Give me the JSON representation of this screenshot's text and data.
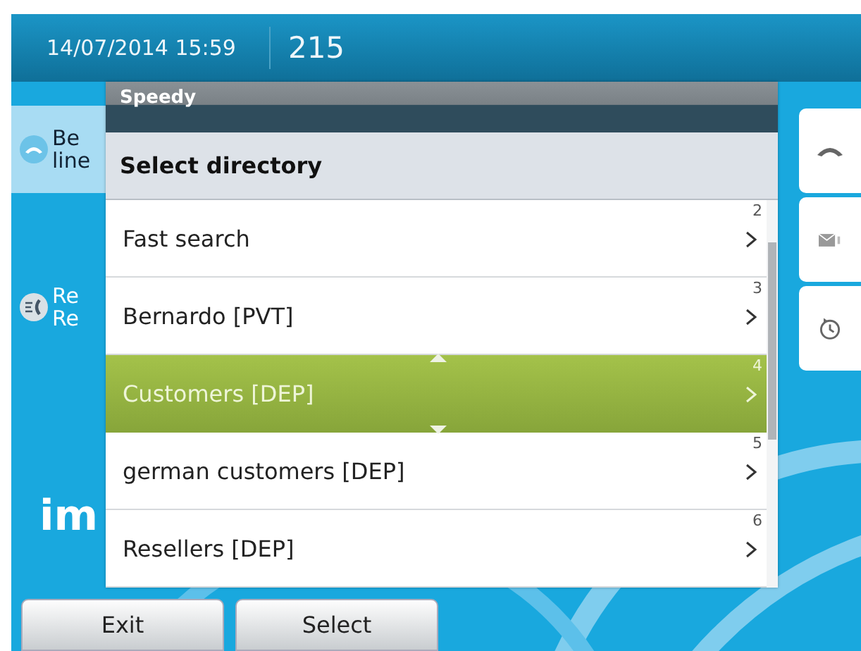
{
  "status_bar": {
    "datetime": "14/07/2014 15:59",
    "extension": "215"
  },
  "entries": [
    {
      "kind": "call",
      "line_1": "Be",
      "line_2": "line"
    },
    {
      "kind": "redial",
      "line_1": "Re",
      "line_2": "Re"
    }
  ],
  "logo_fragment": "im",
  "dialog": {
    "title": "Speedy",
    "heading": "Select directory",
    "items": [
      {
        "label": "Fast search",
        "number": "2",
        "selected": false
      },
      {
        "label": "Bernardo [PVT]",
        "number": "3",
        "selected": false
      },
      {
        "label": "Customers [DEP]",
        "number": "4",
        "selected": true
      },
      {
        "label": "german customers [DEP]",
        "number": "5",
        "selected": false
      },
      {
        "label": "Resellers [DEP]",
        "number": "6",
        "selected": false
      }
    ]
  },
  "softkeys": [
    {
      "label": "Exit"
    },
    {
      "label": "Select"
    }
  ]
}
